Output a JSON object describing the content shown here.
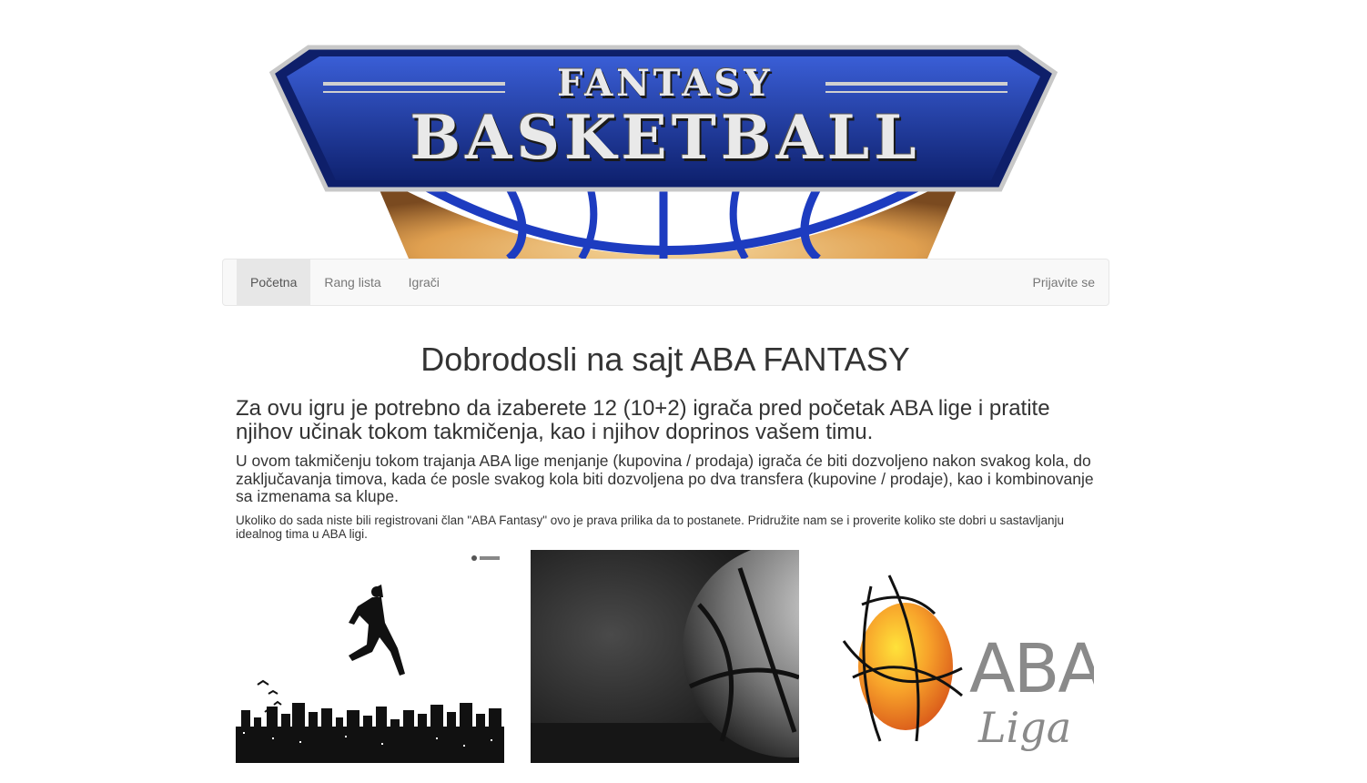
{
  "banner": {
    "top_text": "FANTASY",
    "main_text": "BASKETBALL"
  },
  "nav": {
    "items": [
      {
        "label": "Početna",
        "active": true
      },
      {
        "label": "Rang lista",
        "active": false
      },
      {
        "label": "Igrači",
        "active": false
      }
    ],
    "login_label": "Prijavite se"
  },
  "main": {
    "title": "Dobrodosli na sajt ABA FANTASY",
    "lead_large": "Za ovu igru je potrebno da izaberete 12 (10+2) igrača pred početak ABA lige i pratite njihov učinak tokom takmičenja, kao i njihov doprinos vašem timu.",
    "lead_medium": "U ovom takmičenju tokom trajanja ABA lige menjanje (kupovina / prodaja) igrača će biti dozvoljeno nakon svakog kola, do zaključavanja timova, kada će posle svakog kola biti dozvoljena po dva transfera (kupovine / prodaje), kao i kombinovanje sa izmenama sa klupe.",
    "lead_small": "Ukoliko do sada niste bili registrovani član \"ABA Fantasy\" ovo je prava prilika da to postanete. Pridružite nam se i proverite koliko ste dobri u sastavljanju idealnog tima u ABA ligi."
  },
  "images": {
    "aba_logo_text": "ABA",
    "liga_logo_text": "Liga"
  },
  "colors": {
    "navbar_bg": "#f8f8f8",
    "nav_active_bg": "#e7e7e7",
    "banner_blue": "#1f3fa8",
    "ball_orange": "#f08a1c"
  }
}
